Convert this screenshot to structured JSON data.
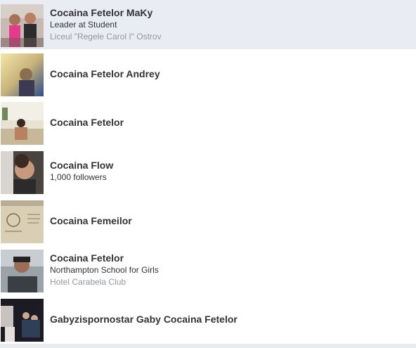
{
  "results": [
    {
      "name": "Cocaina Fetelor MaKy",
      "line1": "Leader at Student",
      "line2": "Liceul \"Regele Carol I\" Ostrov",
      "selected": true
    },
    {
      "name": "Cocaina Fetelor Andrey",
      "line1": "",
      "line2": ""
    },
    {
      "name": "Cocaina Fetelor",
      "line1": "",
      "line2": ""
    },
    {
      "name": "Cocaina Flow",
      "line1": "1,000 followers",
      "line2": ""
    },
    {
      "name": "Cocaina Femeilor",
      "line1": "",
      "line2": ""
    },
    {
      "name": "Cocaina Fetelor",
      "line1": "Northampton School for Girls",
      "line2": "Hotel Carabela Club"
    },
    {
      "name": "Gabyzispornostar Gaby Cocaina Fetelor",
      "line1": "",
      "line2": ""
    }
  ],
  "colors": {
    "selected_row_bg": "#e9ecf3",
    "name_text": "#333333",
    "secondary_text": "#9197a3"
  }
}
